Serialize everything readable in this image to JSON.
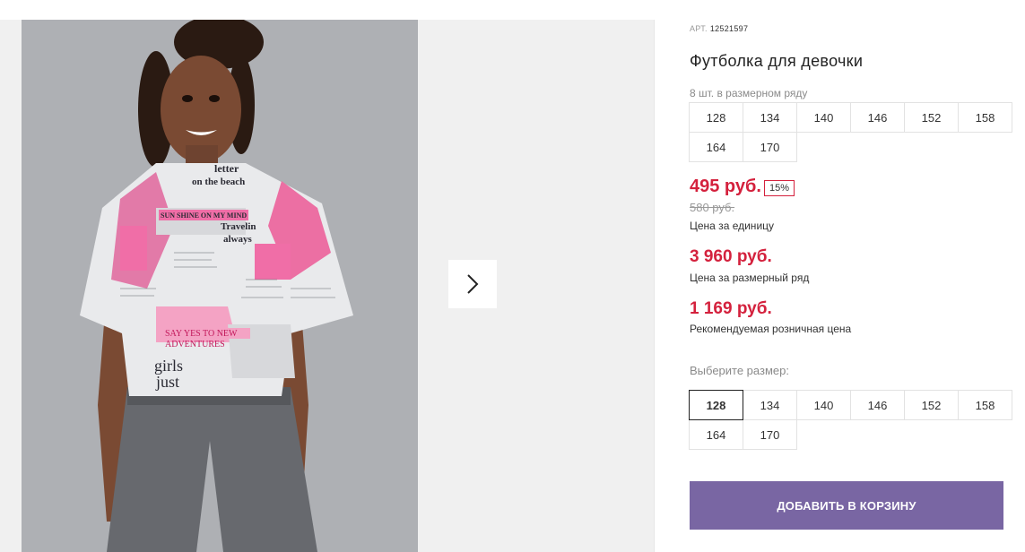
{
  "product": {
    "sku_label": "АРТ.",
    "sku": "12521597",
    "title": "Футболка для девочки",
    "pack_label": "8 шт. в размерном ряду",
    "pack_sizes": [
      "128",
      "134",
      "140",
      "146",
      "152",
      "158",
      "164",
      "170"
    ],
    "price": "495 руб.",
    "discount": "15%",
    "old_price": "580 руб.",
    "unit_price_label": "Цена за единицу",
    "set_price": "3 960 руб.",
    "set_price_label": "Цена за размерный ряд",
    "rrp": "1 169 руб.",
    "rrp_label": "Рекомендуемая розничная цена",
    "choose_size_label": "Выберите размер:",
    "sizes": [
      "128",
      "134",
      "140",
      "146",
      "152",
      "158",
      "164",
      "170"
    ],
    "selected_size": "128",
    "add_to_cart": "ДОБАВИТЬ В КОРЗИНУ"
  },
  "shirt_print": {
    "l1": "letter",
    "l2": "on the beach",
    "l3": "SUN SHINE ON MY MIND",
    "l4": "Travelin",
    "l5": "always",
    "l6": "SAY YES TO NEW",
    "l7": "ADVENTURES",
    "l8": "girls",
    "l9": "just"
  },
  "colors": {
    "accent_price": "#d4213d",
    "cart_button": "#7966a3",
    "photo_bg": "#aeb0b4",
    "print_pink": "#ec6fa3"
  }
}
